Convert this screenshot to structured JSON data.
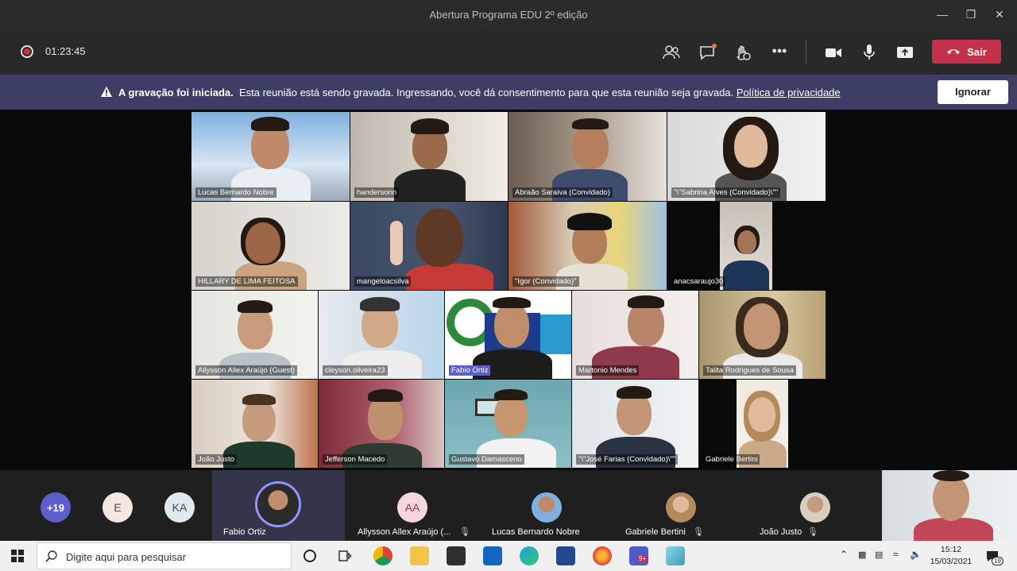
{
  "window": {
    "title": "Abertura Programa EDU 2º edição"
  },
  "toolbar": {
    "timer": "01:23:45",
    "leave_label": "Sair"
  },
  "banner": {
    "bold": "A gravação foi iniciada.",
    "text": "Esta reunião está sendo gravada. Ingressando, você dá consentimento para que esta reunião seja gravada.",
    "link": "Política de privacidade",
    "ignore_label": "Ignorar"
  },
  "tiles": [
    {
      "name": "Lucas Bernardo Nobre"
    },
    {
      "name": "handersonn"
    },
    {
      "name": "Abraão Saraiva (Convidado)"
    },
    {
      "name": "\"\\\"Sabrina Alves (Convidado)\\\"\""
    },
    {
      "name": "HILLARY DE LIMA FEITOSA"
    },
    {
      "name": "mangeloacsilva"
    },
    {
      "name": "\"Igor (Convidado)\""
    },
    {
      "name": "anacsaraujo30"
    },
    {
      "name": "Allysson Allex Araújo (Guest)"
    },
    {
      "name": "cleyson.oliveira23"
    },
    {
      "name": "Fabio Ortiz"
    },
    {
      "name": "Martonio Mendes"
    },
    {
      "name": "Talita Rodrigues de Sousa"
    },
    {
      "name": "João Justo"
    },
    {
      "name": "Jefferson Macedo"
    },
    {
      "name": "Gustavo Damasceno"
    },
    {
      "name": "\"\\\"José Farias (Convidado)\\\"\""
    },
    {
      "name": "Gabriele Bertini"
    }
  ],
  "strip": {
    "more": "+19",
    "chip_e": "E",
    "chip_ka": "KA",
    "chip_aa": "AA",
    "names": [
      "Fabio Ortiz",
      "Allysson Allex Araújo (...",
      "Lucas Bernardo Nobre",
      "Gabriele Bertini",
      "João Justo"
    ]
  },
  "taskbar": {
    "search_placeholder": "Digite aqui para pesquisar",
    "time": "15:12",
    "date": "15/03/2021",
    "teams_badge": "9+",
    "notif_count": "19"
  }
}
